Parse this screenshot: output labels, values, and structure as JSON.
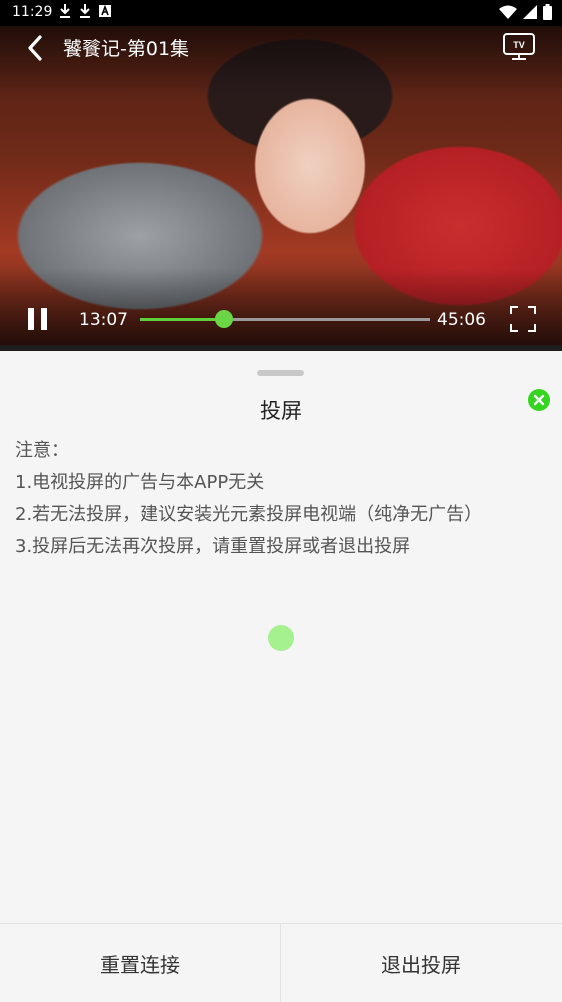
{
  "status_bar": {
    "time": "11:29",
    "left_icons": [
      "download-icon",
      "download-icon",
      "font-a-icon"
    ],
    "right_icons": [
      "wifi-icon",
      "signal-icon",
      "battery-icon"
    ]
  },
  "player": {
    "title": "饕餮记-第01集",
    "current_time": "13:07",
    "total_time": "45:06",
    "progress_fraction": 0.29,
    "accent_color": "#5fcf3c",
    "icons": {
      "back": "chevron-left-icon",
      "cast": "tv-icon",
      "pause": "pause-icon",
      "fullscreen": "fullscreen-icon"
    }
  },
  "sheet": {
    "title": "投屏",
    "close_icon": "close-icon",
    "close_color": "#35d51f",
    "notes": [
      "注意：",
      "1.电视投屏的广告与本APP无关",
      "2.若无法投屏，建议安装光元素投屏电视端（纯净无广告）",
      "3.投屏后无法再次投屏，请重置投屏或者退出投屏"
    ],
    "buttons": {
      "reset": "重置连接",
      "exit": "退出投屏"
    }
  }
}
